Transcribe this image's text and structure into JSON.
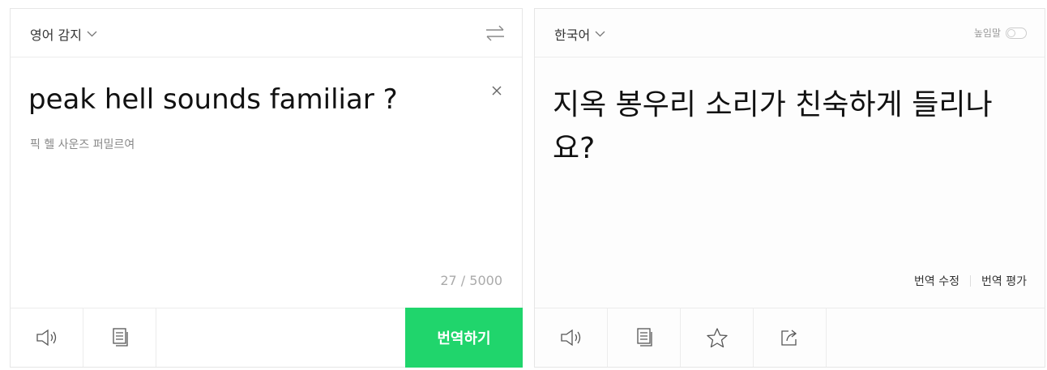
{
  "source": {
    "language": "영어 감지",
    "text": "peak hell sounds familiar ?",
    "pronunciation": "픽 헬 사운즈 퍼밀르여",
    "char_count": "27 / 5000",
    "translate_button": "번역하기"
  },
  "target": {
    "language": "한국어",
    "honorific_label": "높임말",
    "honorific_on": false,
    "text": "지옥 봉우리 소리가 친숙하게 들리나요?",
    "edit_label": "번역 수정",
    "rate_label": "번역 평가"
  },
  "colors": {
    "accent": "#20d56c",
    "border": "#e6e6e6"
  },
  "icons": {
    "swap": "swap-icon",
    "clear": "close-icon",
    "listen": "speaker-icon",
    "copy": "copy-icon",
    "favorite": "star-icon",
    "share": "share-icon"
  }
}
